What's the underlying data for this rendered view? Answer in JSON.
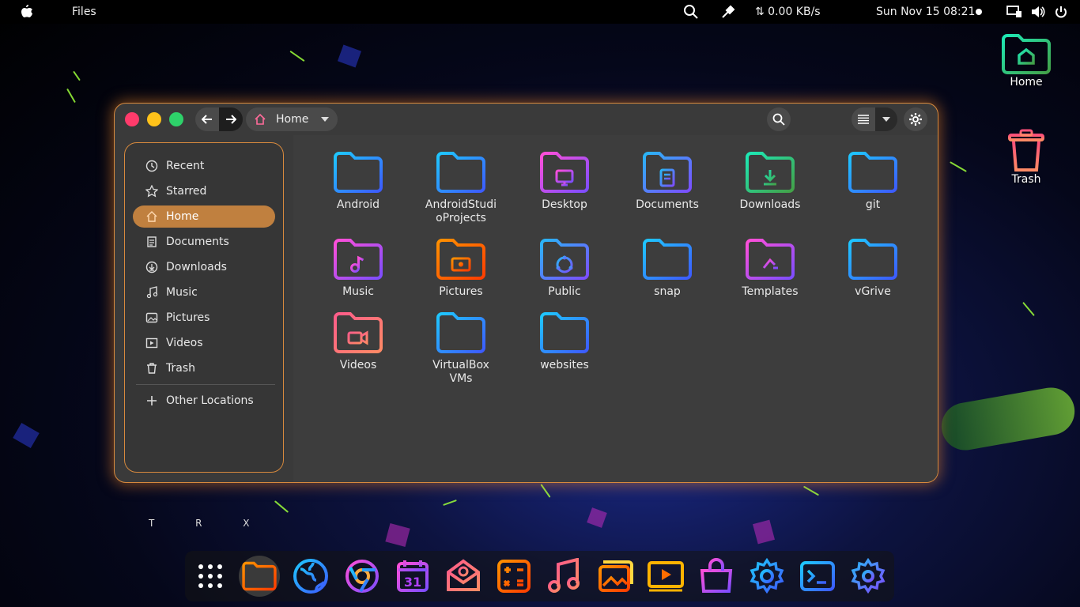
{
  "topbar": {
    "app_name": "Files",
    "network_speed": "⇅ 0.00 KB/s",
    "datetime": "Sun Nov 15  08:21"
  },
  "desktop": {
    "icons": [
      {
        "label": "Home",
        "icon": "home-folder-icon"
      },
      {
        "label": "Trash",
        "icon": "trash-icon"
      }
    ],
    "watermark": "T R X"
  },
  "window": {
    "location": "Home",
    "sidebar": [
      {
        "label": "Recent",
        "icon": "clock-icon"
      },
      {
        "label": "Starred",
        "icon": "star-icon"
      },
      {
        "label": "Home",
        "icon": "home-icon",
        "active": true
      },
      {
        "label": "Documents",
        "icon": "documents-icon"
      },
      {
        "label": "Downloads",
        "icon": "download-icon"
      },
      {
        "label": "Music",
        "icon": "music-icon"
      },
      {
        "label": "Pictures",
        "icon": "pictures-icon"
      },
      {
        "label": "Videos",
        "icon": "videos-icon"
      },
      {
        "label": "Trash",
        "icon": "trash-icon"
      },
      {
        "label": "Other Locations",
        "icon": "plus-icon"
      }
    ],
    "files": [
      {
        "name": "Android",
        "icon": "folder-icon"
      },
      {
        "name": "AndroidStudioProjects",
        "line1": "AndroidStudi",
        "line2": "oProjects",
        "icon": "folder-icon"
      },
      {
        "name": "Desktop",
        "icon": "desktop-folder-icon"
      },
      {
        "name": "Documents",
        "icon": "documents-folder-icon"
      },
      {
        "name": "Downloads",
        "icon": "downloads-folder-icon"
      },
      {
        "name": "git",
        "icon": "folder-icon"
      },
      {
        "name": "Music",
        "icon": "music-folder-icon"
      },
      {
        "name": "Pictures",
        "icon": "pictures-folder-icon"
      },
      {
        "name": "Public",
        "icon": "public-folder-icon"
      },
      {
        "name": "snap",
        "icon": "folder-icon"
      },
      {
        "name": "Templates",
        "icon": "templates-folder-icon"
      },
      {
        "name": "vGrive",
        "icon": "folder-icon"
      },
      {
        "name": "Videos",
        "icon": "videos-folder-icon"
      },
      {
        "name": "VirtualBox VMs",
        "line1": "VirtualBox",
        "line2": "VMs",
        "icon": "folder-icon"
      },
      {
        "name": "websites",
        "icon": "folder-icon"
      }
    ]
  },
  "dock": {
    "calendar_day": "31",
    "apps": [
      "app-grid-icon",
      "files-icon",
      "web-browser-icon",
      "chrome-icon",
      "calendar-icon",
      "mail-icon",
      "calculator-icon",
      "music-player-icon",
      "image-viewer-icon",
      "video-player-icon",
      "software-store-icon",
      "settings-icon",
      "terminal-icon",
      "tweaks-icon"
    ]
  },
  "colors": {
    "accent": "#c0803f",
    "window_glow": "#d7893d",
    "folder_blue": "#2f8cff",
    "folder_pink": "#e040fb"
  }
}
